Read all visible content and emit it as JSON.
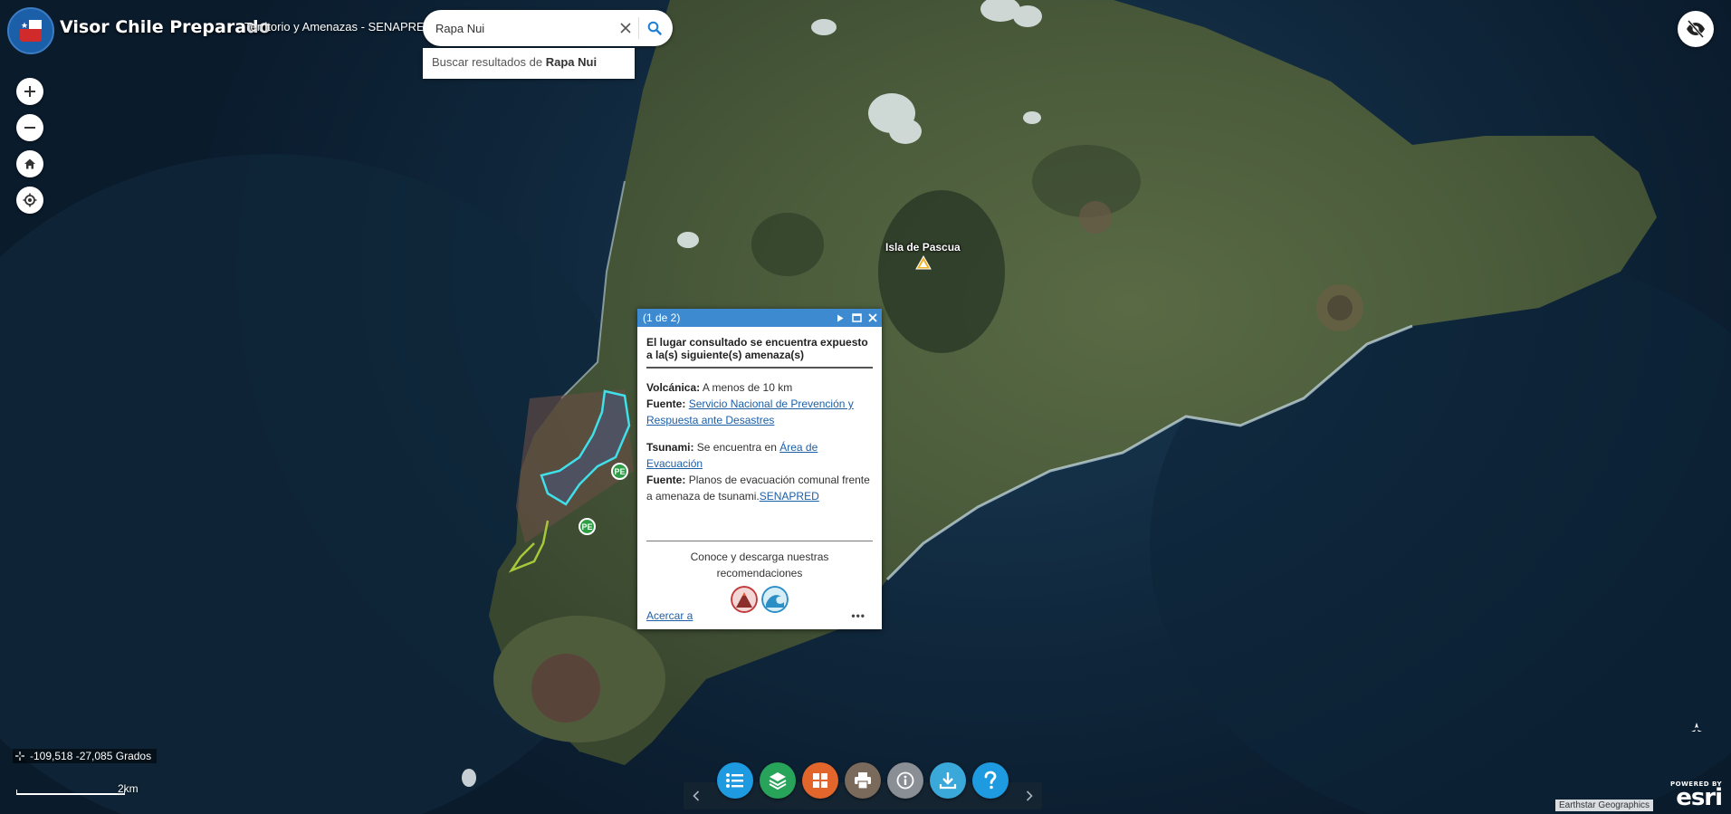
{
  "header": {
    "app_title": "Visor Chile Preparado",
    "subtitle": "Territorio y Amenazas - SENAPRED"
  },
  "search": {
    "value": "Rapa Nui",
    "suggestion_prefix": "Buscar resultados de",
    "suggestion_term": "Rapa Nui"
  },
  "map": {
    "place_label": "Isla de Pascua",
    "marker_pe": "PE",
    "coordinates": "-109,518 -27,085 Grados",
    "scale_label": "2km",
    "attribution": "Earthstar Geographics",
    "esri_powered": "POWERED BY",
    "esri_name": "esri"
  },
  "popup": {
    "counter": "(1 de 2)",
    "title": "El lugar consultado se encuentra expuesto a la(s) siguiente(s) amenaza(s)",
    "volcanic": {
      "label": "Volcánica:",
      "value": "A menos de 10 km",
      "source_label": "Fuente:",
      "source_link": "Servicio Nacional de Prevención y Respuesta ante Desastres"
    },
    "tsunami": {
      "label": "Tsunami:",
      "value": "Se encuentra en",
      "value_link": "Área de Evacuación",
      "source_label": "Fuente:",
      "source_text": "Planos de evacuación comunal frente a amenaza de tsunami.",
      "source_link": "SENAPRED"
    },
    "recommendations": "Conoce y descarga nuestras recomendaciones",
    "zoom_to": "Acercar a",
    "more": "•••"
  },
  "toolbar": {
    "buttons": [
      {
        "icon": "list-icon",
        "color": "#1e9be0"
      },
      {
        "icon": "layers-icon",
        "color": "#27a35a"
      },
      {
        "icon": "grid-icon",
        "color": "#e2662b"
      },
      {
        "icon": "print-icon",
        "color": "#7a6a5c"
      },
      {
        "icon": "info-icon",
        "color": "#8a8f96"
      },
      {
        "icon": "download-icon",
        "color": "#3aa8d8"
      },
      {
        "icon": "help-icon",
        "color": "#1e9be0"
      }
    ]
  },
  "colors": {
    "popup_header": "#3e8ad0",
    "link": "#1d5fa7",
    "evacuation_outline": "#3fe0ea",
    "zone_outline": "#a6c83a"
  }
}
